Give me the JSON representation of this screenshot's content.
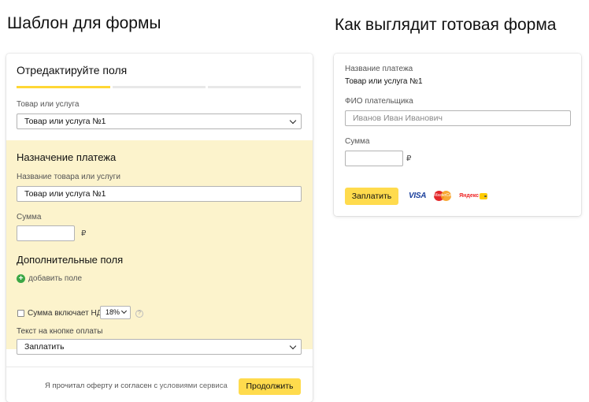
{
  "left": {
    "title": "Шаблон для формы",
    "step_title": "Отредактируйте поля",
    "product_label": "Товар или услуга",
    "product_value": "Товар или услуга №1",
    "purpose_title": "Назначение платежа",
    "name_label": "Название товара или услуги",
    "name_value": "Товар или услуга №1",
    "sum_label": "Сумма",
    "sum_value": "",
    "currency": "₽",
    "extra_title": "Дополнительные поля",
    "add_field": "добавить поле",
    "vat_label": "Сумма включает НДС",
    "vat_value": "18%",
    "help": "?",
    "button_text_label": "Текст на кнопке оплаты",
    "button_text_value": "Заплатить",
    "agreement_prefix": "Я прочитал оферту и согласен с ",
    "agreement_link": "условиями сервиса",
    "continue_button": "Продолжить",
    "progress": {
      "steps": 3,
      "current": 1
    }
  },
  "right": {
    "title": "Как выглядит готовая форма",
    "payment_name_label": "Название платежа",
    "payment_name_value": "Товар или услуга №1",
    "payer_label": "ФИО плательщика",
    "payer_placeholder": "Иванов Иван Иванович",
    "sum_label": "Сумма",
    "sum_value": "",
    "currency": "₽",
    "pay_button": "Заплатить",
    "payment_icons": {
      "visa": "VISA",
      "mastercard": "MasterCard",
      "yandex": "Яндекс"
    }
  },
  "colors": {
    "accent_yellow": "#ffdb4d",
    "section_bg": "#fcf3cc",
    "progress_active": "#ffd735",
    "add_icon": "#3ba745"
  }
}
